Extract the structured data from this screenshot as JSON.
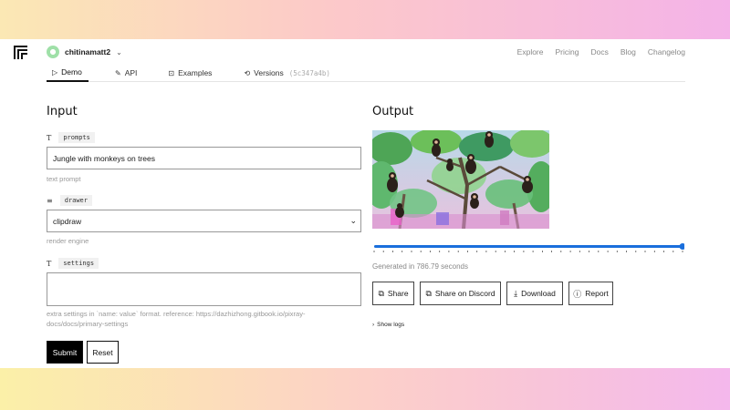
{
  "nav": {
    "username": "chitinamatt2",
    "links": [
      "Explore",
      "Pricing",
      "Docs",
      "Blog",
      "Changelog"
    ]
  },
  "tabs": [
    {
      "icon": "▷",
      "label": "Demo"
    },
    {
      "icon": "✎",
      "label": "API"
    },
    {
      "icon": "⊡",
      "label": "Examples"
    },
    {
      "icon": "⟲",
      "label": "Versions",
      "hash": "(5c347a4b)"
    }
  ],
  "input": {
    "title": "Input",
    "prompts": {
      "type_icon": "T",
      "tag": "prompts",
      "value": "Jungle with monkeys on trees",
      "hint": "text prompt"
    },
    "drawer": {
      "type_icon": "≡",
      "tag": "drawer",
      "value": "clipdraw",
      "hint": "render engine"
    },
    "settings": {
      "type_icon": "T",
      "tag": "settings",
      "value": "",
      "hint": "extra settings in `name: value` format. reference: https://dazhizhong.gitbook.io/pixray-docs/docs/primary-settings"
    },
    "submit_label": "Submit",
    "reset_label": "Reset"
  },
  "output": {
    "title": "Output",
    "slider_fraction": 1.0,
    "generated_text": "Generated in 786.79 seconds",
    "buttons": {
      "share": "Share",
      "discord": "Share on Discord",
      "download": "Download",
      "report": "Report"
    },
    "show_logs": "Show logs"
  },
  "colors": {
    "accent": "#1a6fdc",
    "primary_button": "#000000"
  }
}
